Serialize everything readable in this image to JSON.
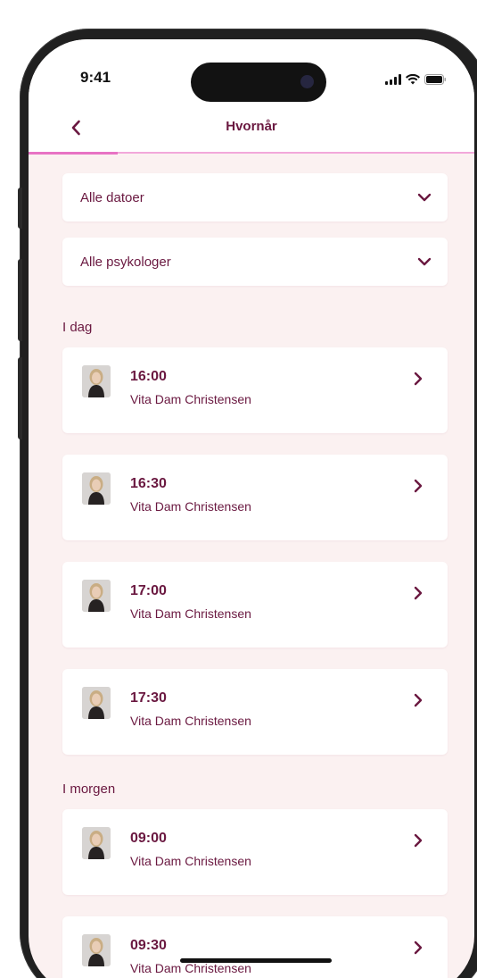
{
  "status": {
    "time": "9:41"
  },
  "nav": {
    "title": "Hvornår",
    "progress_fraction": 0.2
  },
  "filters": {
    "dates_label": "Alle datoer",
    "psychologists_label": "Alle psykologer"
  },
  "sections": [
    {
      "header": "I dag",
      "slots": [
        {
          "time": "16:00",
          "name": "Vita Dam Christensen"
        },
        {
          "time": "16:30",
          "name": "Vita Dam Christensen"
        },
        {
          "time": "17:00",
          "name": "Vita Dam Christensen"
        },
        {
          "time": "17:30",
          "name": "Vita Dam Christensen"
        }
      ]
    },
    {
      "header": "I morgen",
      "slots": [
        {
          "time": "09:00",
          "name": "Vita Dam Christensen"
        },
        {
          "time": "09:30",
          "name": "Vita Dam Christensen"
        }
      ]
    }
  ],
  "colors": {
    "accent": "#6a1840",
    "background": "#fbf1f1",
    "progress": "#e873c4"
  }
}
